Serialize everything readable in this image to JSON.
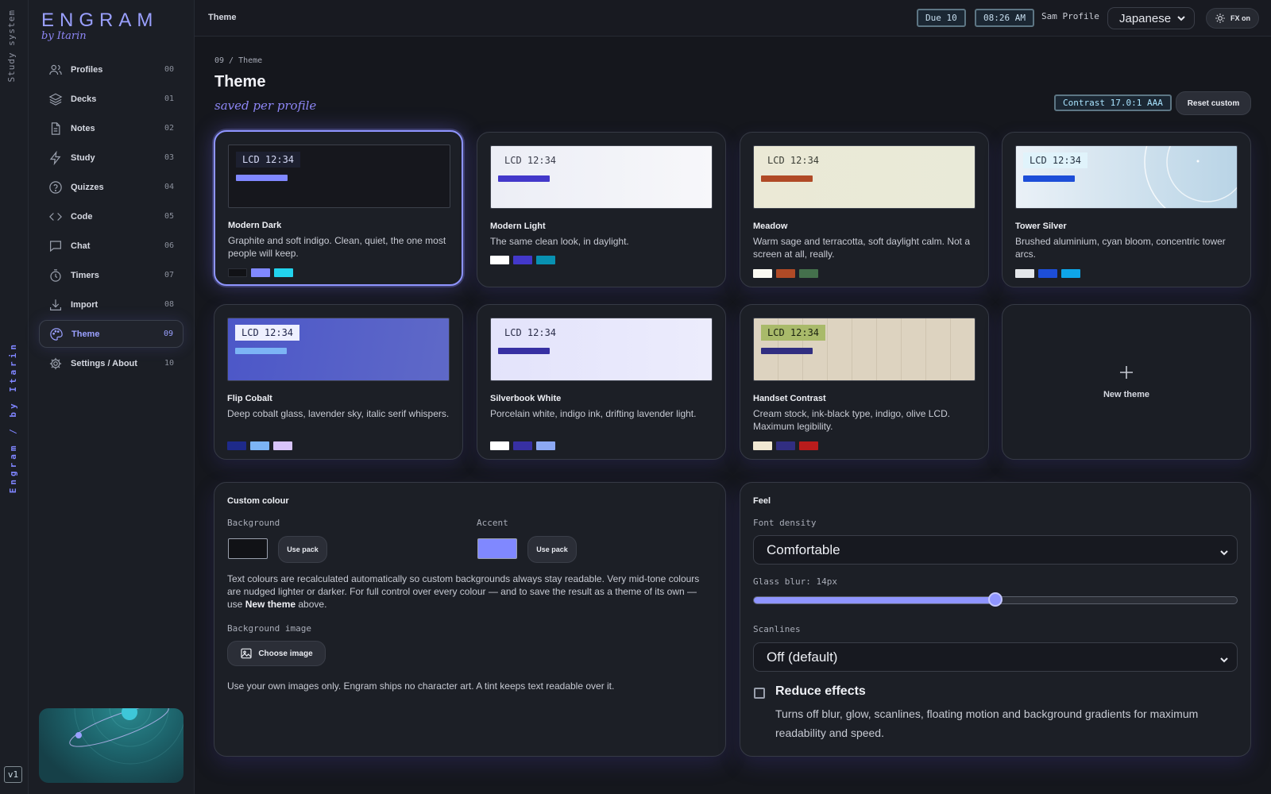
{
  "rail": {
    "top_label": "Study system",
    "brand_label": "Engram / by Itarin",
    "version": "v1"
  },
  "app": {
    "name": "ENGRAM",
    "by": "by Itarin"
  },
  "sidebar": {
    "items": [
      {
        "label": "Profiles",
        "num": "00",
        "icon": "users-icon"
      },
      {
        "label": "Decks",
        "num": "01",
        "icon": "layers-icon"
      },
      {
        "label": "Notes",
        "num": "02",
        "icon": "note-icon"
      },
      {
        "label": "Study",
        "num": "03",
        "icon": "bolt-icon"
      },
      {
        "label": "Quizzes",
        "num": "04",
        "icon": "question-icon"
      },
      {
        "label": "Code",
        "num": "05",
        "icon": "code-icon"
      },
      {
        "label": "Chat",
        "num": "06",
        "icon": "chat-icon"
      },
      {
        "label": "Timers",
        "num": "07",
        "icon": "timer-icon"
      },
      {
        "label": "Import",
        "num": "08",
        "icon": "download-icon"
      },
      {
        "label": "Theme",
        "num": "09",
        "icon": "palette-icon",
        "active": true
      },
      {
        "label": "Settings / About",
        "num": "10",
        "icon": "gear-icon"
      }
    ]
  },
  "topbar": {
    "title": "Theme",
    "due": "Due 10",
    "time": "08:26 AM",
    "profile": "Sam Profile",
    "language": "Japanese",
    "fx_label": "FX on"
  },
  "page": {
    "crumb": "09 / Theme",
    "title": "Theme",
    "subtitle": "saved per profile",
    "contrast": "Contrast 17.0:1 AAA",
    "reset_label": "Reset custom"
  },
  "themes": [
    {
      "name": "Modern Dark",
      "desc": "Graphite and soft indigo. Clean, quiet, the one most people will keep.",
      "lcd": "LCD 12:34",
      "swatches": [
        "#111216",
        "#8088ff",
        "#22d3ee"
      ]
    },
    {
      "name": "Modern Light",
      "desc": "The same clean look, in daylight.",
      "lcd": "LCD 12:34",
      "swatches": [
        "#ffffff",
        "#4338ca",
        "#0891b2"
      ]
    },
    {
      "name": "Meadow",
      "desc": "Warm sage and terracotta, soft daylight calm. Not a screen at all, really.",
      "lcd": "LCD 12:34",
      "swatches": [
        "#fbfaf3",
        "#b04a26",
        "#44704c"
      ]
    },
    {
      "name": "Tower Silver",
      "desc": "Brushed aluminium, cyan bloom, concentric tower arcs.",
      "lcd": "LCD 12:34",
      "swatches": [
        "#e3e6ea",
        "#1d4ed8",
        "#0ea5e9"
      ]
    },
    {
      "name": "Flip Cobalt",
      "desc": "Deep cobalt glass, lavender sky, italic serif whispers.",
      "lcd": "LCD 12:34",
      "swatches": [
        "#1e2a8a",
        "#7cb4f5",
        "#d8c4f9"
      ]
    },
    {
      "name": "Silverbook White",
      "desc": "Porcelain white, indigo ink, drifting lavender light.",
      "lcd": "LCD 12:34",
      "swatches": [
        "#ffffff",
        "#3730a3",
        "#8ca8f3"
      ]
    },
    {
      "name": "Handset Contrast",
      "desc": "Cream stock, ink-black type, indigo, olive LCD. Maximum legibility.",
      "lcd": "LCD 12:34",
      "swatches": [
        "#f1e8d3",
        "#312e81",
        "#b91c1c"
      ]
    }
  ],
  "new_theme_label": "New theme",
  "custom": {
    "title": "Custom colour",
    "background_label": "Background",
    "background_color": "#111216",
    "accent_label": "Accent",
    "accent_color": "#8088ff",
    "use_pack": "Use pack",
    "help_part1": "Text colours are recalculated automatically so custom backgrounds always stay readable. Very mid-tone colours are nudged lighter or darker. For full control over every colour — and to save the result as a theme of its own — use ",
    "help_bold": "New theme",
    "help_part2": " above.",
    "bg_image_label": "Background image",
    "choose_image": "Choose image",
    "image_note": "Use your own images only. Engram ships no character art. A tint keeps text readable over it."
  },
  "feel": {
    "title": "Feel",
    "density_label": "Font density",
    "density_value": "Comfortable",
    "blur_label": "Glass blur: 14px",
    "blur_fraction": 0.5,
    "scanlines_label": "Scanlines",
    "scanlines_value": "Off (default)",
    "reduce_label": "Reduce effects",
    "reduce_desc": "Turns off blur, glow, scanlines, floating motion and background gradients for maximum readability and speed."
  },
  "colors": {
    "accent": "#8f95ff",
    "background": "#15171d"
  }
}
